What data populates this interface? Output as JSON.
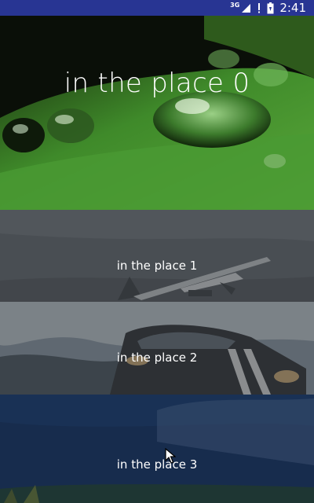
{
  "status_bar": {
    "network": "3G",
    "time": "2:41"
  },
  "list": {
    "items": [
      {
        "label": "in the place 0",
        "image": "water-droplets-on-leaf"
      },
      {
        "label": "in the place 1",
        "image": "jet-airplane-in-sky"
      },
      {
        "label": "in the place 2",
        "image": "sports-car-on-road"
      },
      {
        "label": "in the place 3",
        "image": "sky-and-plants"
      }
    ]
  },
  "colors": {
    "status_bar": "#283593",
    "label_text": "#ffffff",
    "dim_overlay": "#3c4044"
  }
}
